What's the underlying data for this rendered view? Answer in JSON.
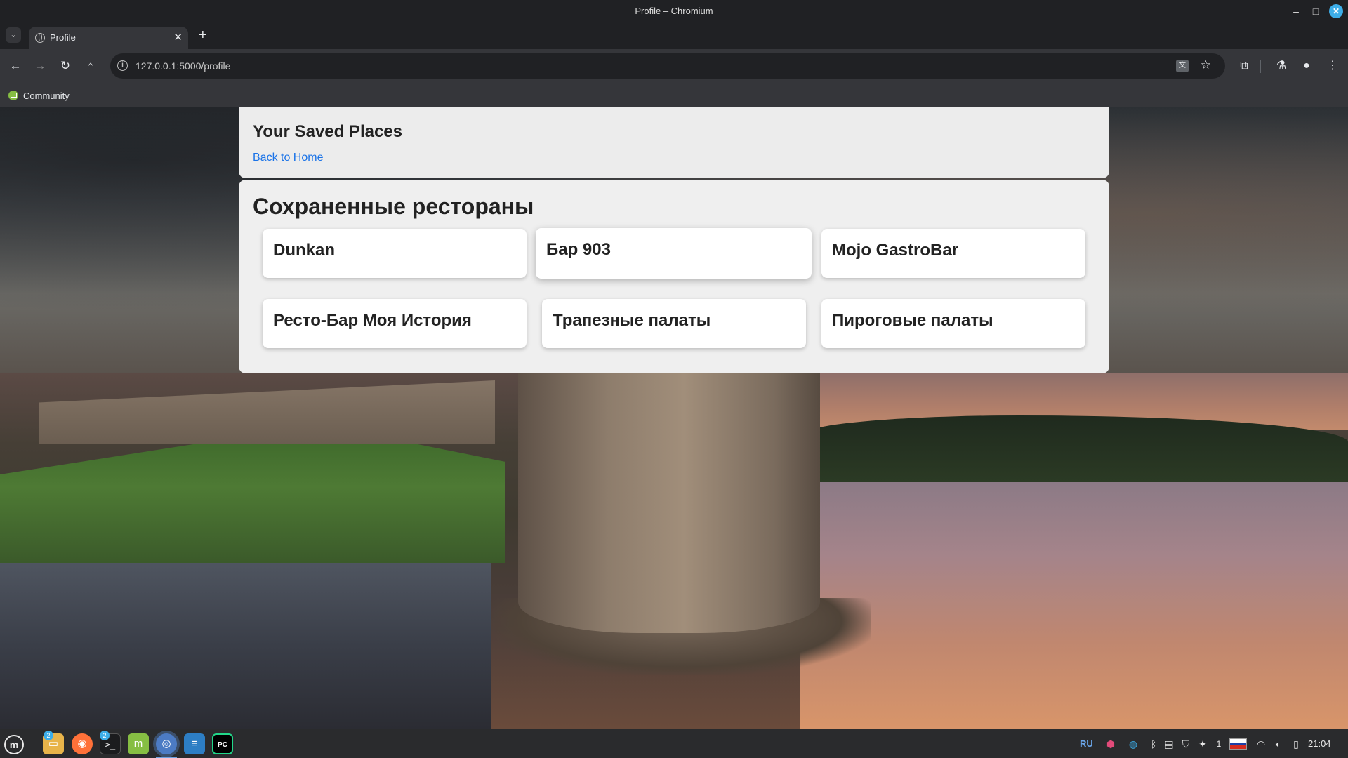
{
  "window": {
    "title": "Profile – Chromium",
    "minimize": "–",
    "maximize": "□",
    "close": "✕"
  },
  "tabs": [
    {
      "title": "Profile",
      "close": "✕"
    }
  ],
  "toolbar": {
    "url": "127.0.0.1:5000/profile",
    "icons": [
      "back-icon",
      "forward-icon",
      "reload-icon",
      "home-icon",
      "site-info-icon",
      "translate-icon",
      "bookmark-star-icon",
      "extensions-icon",
      "labs-icon",
      "profile-icon",
      "menu-icon"
    ]
  },
  "bookmarks": [
    {
      "label": "Community"
    }
  ],
  "page": {
    "header": {
      "title": "Your Saved Places",
      "back_link": "Back to Home"
    },
    "saved": {
      "section_title": "Сохраненные рестораны",
      "restaurants": [
        {
          "name": "Dunkan"
        },
        {
          "name": "Бар 903"
        },
        {
          "name": "Mojo GastroBar"
        },
        {
          "name": "Ресто-Бар Моя История"
        },
        {
          "name": "Трапезные палаты"
        },
        {
          "name": "Пироговые палаты"
        }
      ]
    }
  },
  "taskbar": {
    "apps": [
      "files",
      "firefox",
      "terminal",
      "mint-update",
      "chromium",
      "text-editor",
      "pycharm"
    ],
    "badges": {
      "files": "2",
      "terminal": "2"
    },
    "pycharm_label": "PC",
    "tray": {
      "language": "RU",
      "notifications_count": "1",
      "clock": "21:04"
    }
  },
  "colors": {
    "link": "#1a73e8",
    "card_bg": "#ffffff",
    "panel_bg": "#ececec",
    "chrome_dark": "#202124",
    "chrome_toolbar": "#35363a"
  }
}
